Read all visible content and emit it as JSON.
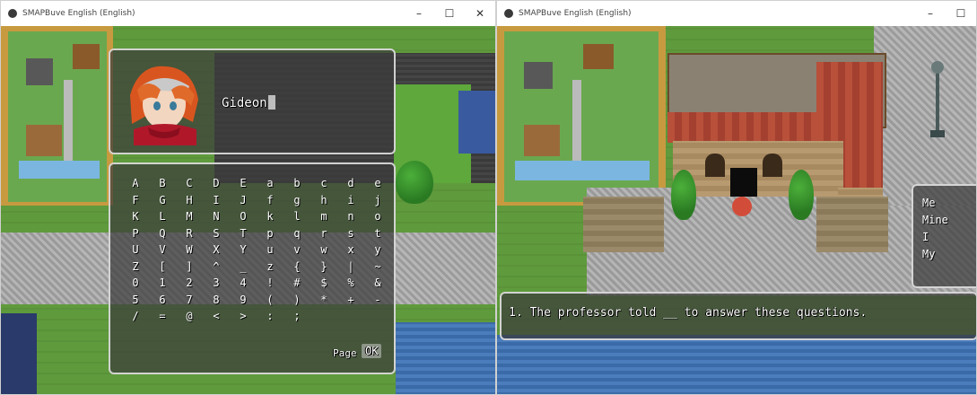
{
  "left_window": {
    "title": "SMAPBuve English (English)",
    "controls": {
      "minimize": "–",
      "maximize": "☐",
      "close": "✕"
    },
    "name_input": {
      "value": "Gideon"
    },
    "keyboard": {
      "rows": [
        [
          "A",
          "B",
          "C",
          "D",
          "E",
          "a",
          "b",
          "c",
          "d",
          "e"
        ],
        [
          "F",
          "G",
          "H",
          "I",
          "J",
          "f",
          "g",
          "h",
          "i",
          "j"
        ],
        [
          "K",
          "L",
          "M",
          "N",
          "O",
          "k",
          "l",
          "m",
          "n",
          "o"
        ],
        [
          "P",
          "Q",
          "R",
          "S",
          "T",
          "p",
          "q",
          "r",
          "s",
          "t"
        ],
        [
          "U",
          "V",
          "W",
          "X",
          "Y",
          "u",
          "v",
          "w",
          "x",
          "y"
        ],
        [
          "Z",
          "[",
          "]",
          "^",
          "_",
          "z",
          "{",
          "}",
          "|",
          "~"
        ],
        [
          "0",
          "1",
          "2",
          "3",
          "4",
          "!",
          "#",
          "$",
          "%",
          "&"
        ],
        [
          "5",
          "6",
          "7",
          "8",
          "9",
          "(",
          ")",
          "*",
          "+",
          "-"
        ],
        [
          "/",
          "=",
          "@",
          "<",
          ">",
          ":",
          ";",
          "",
          "",
          ""
        ]
      ],
      "page_label": "Page",
      "ok_label": "OK"
    }
  },
  "right_window": {
    "title": "SMAPBuve English (English)",
    "controls": {
      "minimize": "–",
      "maximize": "☐"
    },
    "choices": [
      "Me",
      "Mine",
      "I",
      "My"
    ],
    "message": "1. The professor told __ to answer these questions."
  },
  "colors": {
    "window_fill": "#3c3c3c",
    "window_border": "#ebebeb",
    "grass": "#5f9a3c",
    "cobble": "#a8a8a8"
  }
}
